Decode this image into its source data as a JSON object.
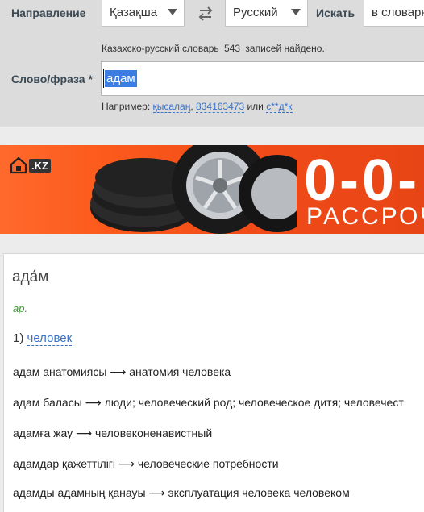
{
  "search": {
    "direction_label": "Направление",
    "from_lang": "Қазақша",
    "to_lang": "Русский",
    "search_label": "Искать",
    "search_scope": "в словарн",
    "count_text_before": "Казахско-русский словарь",
    "count_number": "543",
    "count_text_after": "записей найдено.",
    "query_label": "Слово/фраза",
    "required_mark": "*",
    "query_value": "адам",
    "example_prefix": "Например:",
    "example_1": "қысалаң",
    "example_sep": ",",
    "example_2": "834163473",
    "example_or": "или",
    "example_3": "с**д*к"
  },
  "ad": {
    "logo_text": ".KZ",
    "headline": "0-0-",
    "subline": "РАССРОЧ"
  },
  "result": {
    "headword": "ада́м",
    "pos": "ар.",
    "sense_number": "1)",
    "sense_translation": "человек",
    "phrases": [
      "адам анатомиясы ⟶ анатомия человека",
      "адам баласы ⟶ люди; человеческий род; человеческое дитя; человечест",
      "адамға жау ⟶ человеконенавистный",
      "адамдар қажеттілігі ⟶ человеческие потребности",
      "адамды адамның қанауы ⟶ эксплуатация человека человеком"
    ]
  },
  "colors": {
    "panel_bg": "#dcdcdc",
    "link": "#3b73c6",
    "pos_green": "#3c9a32",
    "ad_orange": "#f04b18"
  }
}
